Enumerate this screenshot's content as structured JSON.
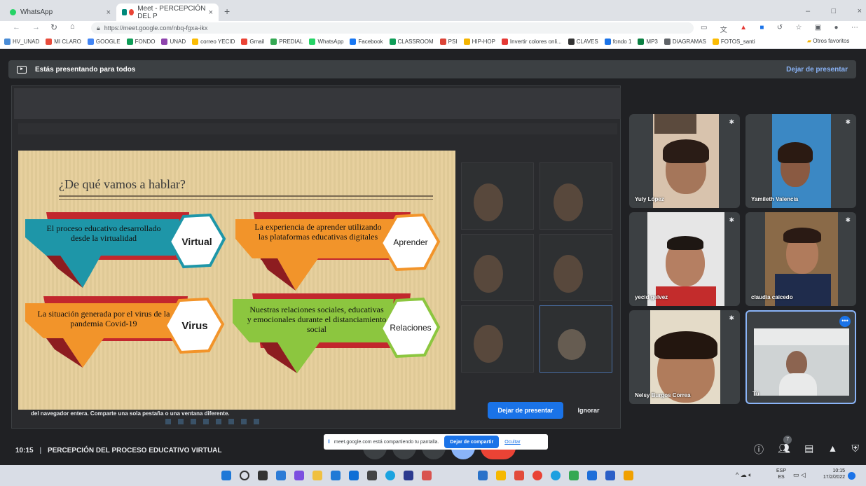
{
  "browser": {
    "tabs": [
      {
        "label": "WhatsApp",
        "close": "×"
      },
      {
        "label": "Meet - PERCEPCIÓN DEL P",
        "close": "×"
      }
    ],
    "new_tab": "+",
    "url": "https://meet.google.com/nbq-fgxa-ikx",
    "window_controls": [
      "–",
      "□",
      "×"
    ],
    "bookmarks": [
      "HV_UNAD",
      "MI CLARO",
      "GOOGLE",
      "FONDO",
      "UNAD",
      "correo YECID",
      "Gmail",
      "PREDIAL",
      "WhatsApp",
      "Facebook",
      "CLASSROOM",
      "PSI",
      "HIP-HOP",
      "Invertir colores onli...",
      "CLAVES",
      "fondo 1",
      "MP3",
      "DIAGRAMAS",
      "FOTOS_santi"
    ],
    "other_favorites": "Otros favoritos",
    "bookmark_colors": [
      "#4a8cd6",
      "#e74c3c",
      "#4285f4",
      "#0f9d58",
      "#8e44ad",
      "#fbbc04",
      "#ea4335",
      "#34a853",
      "#25d366",
      "#1877f2",
      "#0f9d58",
      "#db4437",
      "#f4b400",
      "#e53935",
      "#333333",
      "#1a73e8",
      "#0b8043",
      "#5f6368",
      "#fbbc04"
    ]
  },
  "meet": {
    "presenting_text": "Estás presentando para todos",
    "stop_presenting_link": "Dejar de presentar",
    "stop_presenting_button": "Dejar de presentar",
    "ignore_button": "Ignorar",
    "bottom_message": "del navegador entera. Comparte una sola pestaña o una ventana diferente.",
    "meeting_time": "10:15",
    "meeting_title": "PERCEPCIÓN DEL PROCESO EDUCATIVO VIRTUAL",
    "share_notice": "meet.google.com está compartiendo tu pantalla.",
    "stop_sharing": "Dejar de compartir",
    "hide": "Ocultar",
    "people_badge": "7"
  },
  "slide": {
    "title": "¿De qué vamos a hablar?",
    "items": [
      {
        "text": "El proceso educativo desarrollado desde la virtualidad",
        "hex": "Virtual"
      },
      {
        "text": "La experiencia de aprender utilizando las plataformas educativas digitales",
        "hex": "Aprender"
      },
      {
        "text": "La situación generada por el virus de la pandemia Covid-19",
        "hex": "Virus"
      },
      {
        "text": "Nuestras relaciones sociales, educativas y emocionales durante el distanciamiento social",
        "hex": "Relaciones"
      }
    ],
    "colors": {
      "teal": "#1e96a8",
      "orange": "#f2942a",
      "green": "#8cc63f",
      "red": "#c2272d"
    }
  },
  "participants": [
    {
      "name": "Yuly López"
    },
    {
      "name": "Yamileth Valencia"
    },
    {
      "name": "yecid gelvez"
    },
    {
      "name": "claudia caicedo"
    },
    {
      "name": "Nelsy Burgos Correa"
    },
    {
      "name": "Tú"
    }
  ],
  "taskbar": {
    "lang": "ESP",
    "region": "ES",
    "time": "10:15",
    "date": "17/2/2022"
  }
}
